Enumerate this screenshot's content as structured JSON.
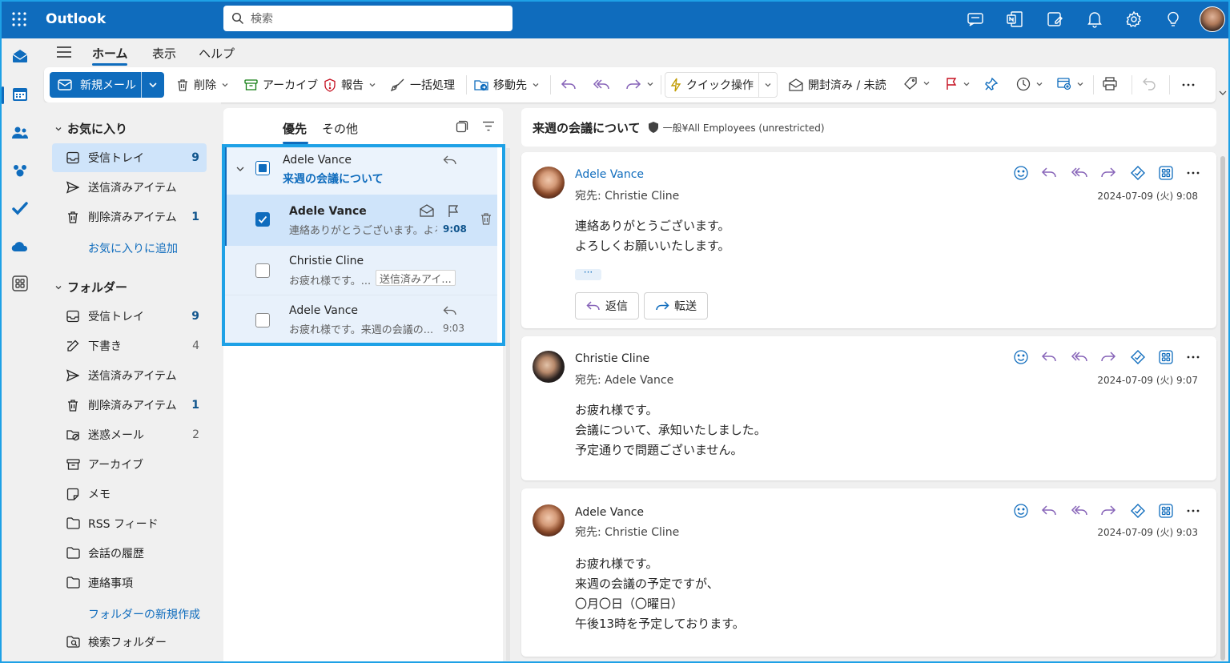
{
  "app": {
    "title": "Outlook"
  },
  "search": {
    "placeholder": "検索"
  },
  "tabs": [
    "ホーム",
    "表示",
    "ヘルプ"
  ],
  "ribbon": {
    "new_mail": "新規メール",
    "delete": "削除",
    "archive": "アーカイブ",
    "report": "報告",
    "sweep": "一括処理",
    "move": "移動先",
    "quick_steps": "クイック操作",
    "read_unread": "開封済み / 未読"
  },
  "favorites": {
    "header": "お気に入り",
    "items": [
      {
        "label": "受信トレイ",
        "count": "9"
      },
      {
        "label": "送信済みアイテム",
        "count": ""
      },
      {
        "label": "削除済みアイテム",
        "count": "1"
      }
    ],
    "add_link": "お気に入りに追加"
  },
  "folders": {
    "header": "フォルダー",
    "items": [
      {
        "label": "受信トレイ",
        "count": "9"
      },
      {
        "label": "下書き",
        "count": "4"
      },
      {
        "label": "送信済みアイテム",
        "count": ""
      },
      {
        "label": "削除済みアイテム",
        "count": "1"
      },
      {
        "label": "迷惑メール",
        "count": "2"
      },
      {
        "label": "アーカイブ",
        "count": ""
      },
      {
        "label": "メモ",
        "count": ""
      },
      {
        "label": "RSS フィード",
        "count": ""
      },
      {
        "label": "会話の履歴",
        "count": ""
      },
      {
        "label": "連絡事項",
        "count": ""
      }
    ],
    "new_folder_link": "フォルダーの新規作成",
    "search_folder": "検索フォルダー"
  },
  "message_list": {
    "tabs": [
      "優先",
      "その他"
    ],
    "conversation": {
      "sender": "Adele Vance",
      "subject": "来週の会議について"
    },
    "items": [
      {
        "sender": "Adele Vance",
        "preview": "連絡ありがとうございます。よろ...",
        "time": "9:08",
        "tag": ""
      },
      {
        "sender": "Christie Cline",
        "preview": "お疲れ様です。...",
        "time": "",
        "tag": "送信済みアイ..."
      },
      {
        "sender": "Adele Vance",
        "preview": "お疲れ様です。来週の会議の...",
        "time": "9:03",
        "tag": ""
      }
    ]
  },
  "reading": {
    "subject": "来週の会議について",
    "label": "一般¥All Employees (unrestricted)",
    "to_prefix": "宛先:",
    "messages": [
      {
        "sender": "Adele Vance",
        "to": "Christie Cline",
        "date": "2024-07-09 (火) 9:08",
        "lines": [
          "連絡ありがとうございます。",
          "よろしくお願いいたします。"
        ]
      },
      {
        "sender": "Christie Cline",
        "to": "Adele Vance",
        "date": "2024-07-09 (火) 9:07",
        "lines": [
          "お疲れ様です。",
          "会議について、承知いたしました。",
          "予定通りで問題ございません。"
        ]
      },
      {
        "sender": "Adele Vance",
        "to": "Christie Cline",
        "date": "2024-07-09 (火) 9:03",
        "lines": [
          "お疲れ様です。",
          "来週の会議の予定ですが、",
          "〇月〇日（〇曜日）",
          "午後13時を予定しております。"
        ]
      }
    ],
    "reply_label": "返信",
    "forward_label": "転送",
    "more": "···"
  },
  "colors": {
    "brand": "#0f6cbd",
    "highlight": "#1ea1e6",
    "selected": "#cfe4fa"
  }
}
